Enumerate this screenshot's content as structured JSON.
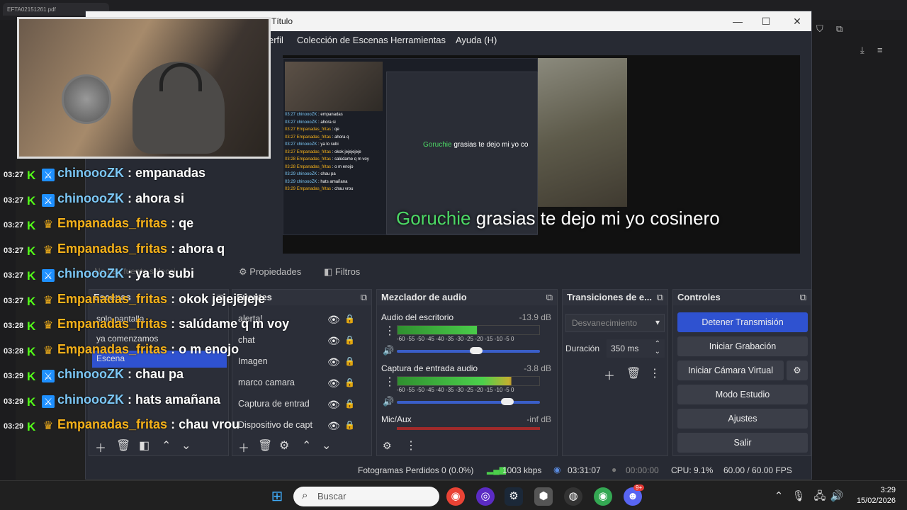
{
  "browser": {
    "tab_title": "EFTA02151261.pdf"
  },
  "obs": {
    "title": "Título",
    "menu": [
      "erfil",
      "Colección de Escenas",
      "Herramientas",
      "Ayuda (H)"
    ],
    "overlay": {
      "user": "Goruchie",
      "text": "grasias te dejo mi yo cosinero"
    },
    "mini_overlay": {
      "user": "Goruchie",
      "text": "grasias te dejo mi yo co"
    },
    "tabs": {
      "properties": "Propiedades",
      "filters": "Filtros",
      "no_source": "No hay fuente selecci"
    },
    "docks": {
      "scenes_title": "Escenas",
      "scenes": [
        "solo pantalla",
        "ya comenzamos",
        "Escena"
      ],
      "sources_title": "Fuentes",
      "sources": [
        "alerta!",
        "chat",
        "Imagen",
        "marco camara",
        "Captura de entrad",
        "Dispositivo de capt"
      ],
      "mixer_title": "Mezclador de audio",
      "mixer": [
        {
          "name": "Audio del escritorio",
          "db": "-13.9 dB",
          "level": 0.56
        },
        {
          "name": "Captura de entrada audio",
          "db": "-3.8 dB",
          "level": 0.8
        },
        {
          "name": "Mic/Aux",
          "db": "-inf dB",
          "level": 0
        }
      ],
      "meter_scale": "-60 -55 -50 -45 -40 -35 -30 -25 -20 -15 -10 -5 0",
      "transitions_title": "Transiciones de e...",
      "transition_select": "Desvanecimiento",
      "duration_label": "Duración",
      "duration_value": "350 ms",
      "controls_title": "Controles",
      "controls": [
        "Detener Transmisión",
        "Iniciar Grabación",
        "Iniciar Cámara Virtual",
        "Modo Estudio",
        "Ajustes",
        "Salir"
      ]
    },
    "status": {
      "dropped": "Fotogramas Perdidos 0 (0.0%)",
      "bitrate": "1003 kbps",
      "stream_time": "03:31:07",
      "rec_time": "00:00:00",
      "cpu": "CPU: 9.1%",
      "fps": "60.00 / 60.00 FPS"
    }
  },
  "chat": [
    {
      "time": "03:27",
      "badge": "blue",
      "user": "chinoooZK",
      "msg": ": empanadas"
    },
    {
      "time": "03:27",
      "badge": "blue",
      "user": "chinoooZK",
      "msg": ": ahora si"
    },
    {
      "time": "03:27",
      "badge": "gold",
      "user": "Empanadas_fritas",
      "msg": ": qe"
    },
    {
      "time": "03:27",
      "badge": "gold",
      "user": "Empanadas_fritas",
      "msg": ": ahora q"
    },
    {
      "time": "03:27",
      "badge": "blue",
      "user": "chinoooZK",
      "msg": ": ya lo subi"
    },
    {
      "time": "03:27",
      "badge": "gold",
      "user": "Empanadas_fritas",
      "msg": ": okok jejejejeje"
    },
    {
      "time": "03:28",
      "badge": "gold",
      "user": "Empanadas_fritas",
      "msg": ": salúdame q m voy"
    },
    {
      "time": "03:28",
      "badge": "gold",
      "user": "Empanadas_fritas",
      "msg": ": o m enojo"
    },
    {
      "time": "03:29",
      "badge": "blue",
      "user": "chinoooZK",
      "msg": ": chau pa"
    },
    {
      "time": "03:29",
      "badge": "blue",
      "user": "chinoooZK",
      "msg": ": hats amañana"
    },
    {
      "time": "03:29",
      "badge": "gold",
      "user": "Empanadas_fritas",
      "msg": ": chau vrou"
    }
  ],
  "taskbar": {
    "search_placeholder": "Buscar",
    "time": "3:29",
    "date": "15/02/2026",
    "discord_badge": "9+"
  },
  "colors": {
    "kick_green": "#53fc18",
    "gold": "#f6b21a",
    "blue_user": "#7cc7f5",
    "accent": "#2f52d0"
  }
}
